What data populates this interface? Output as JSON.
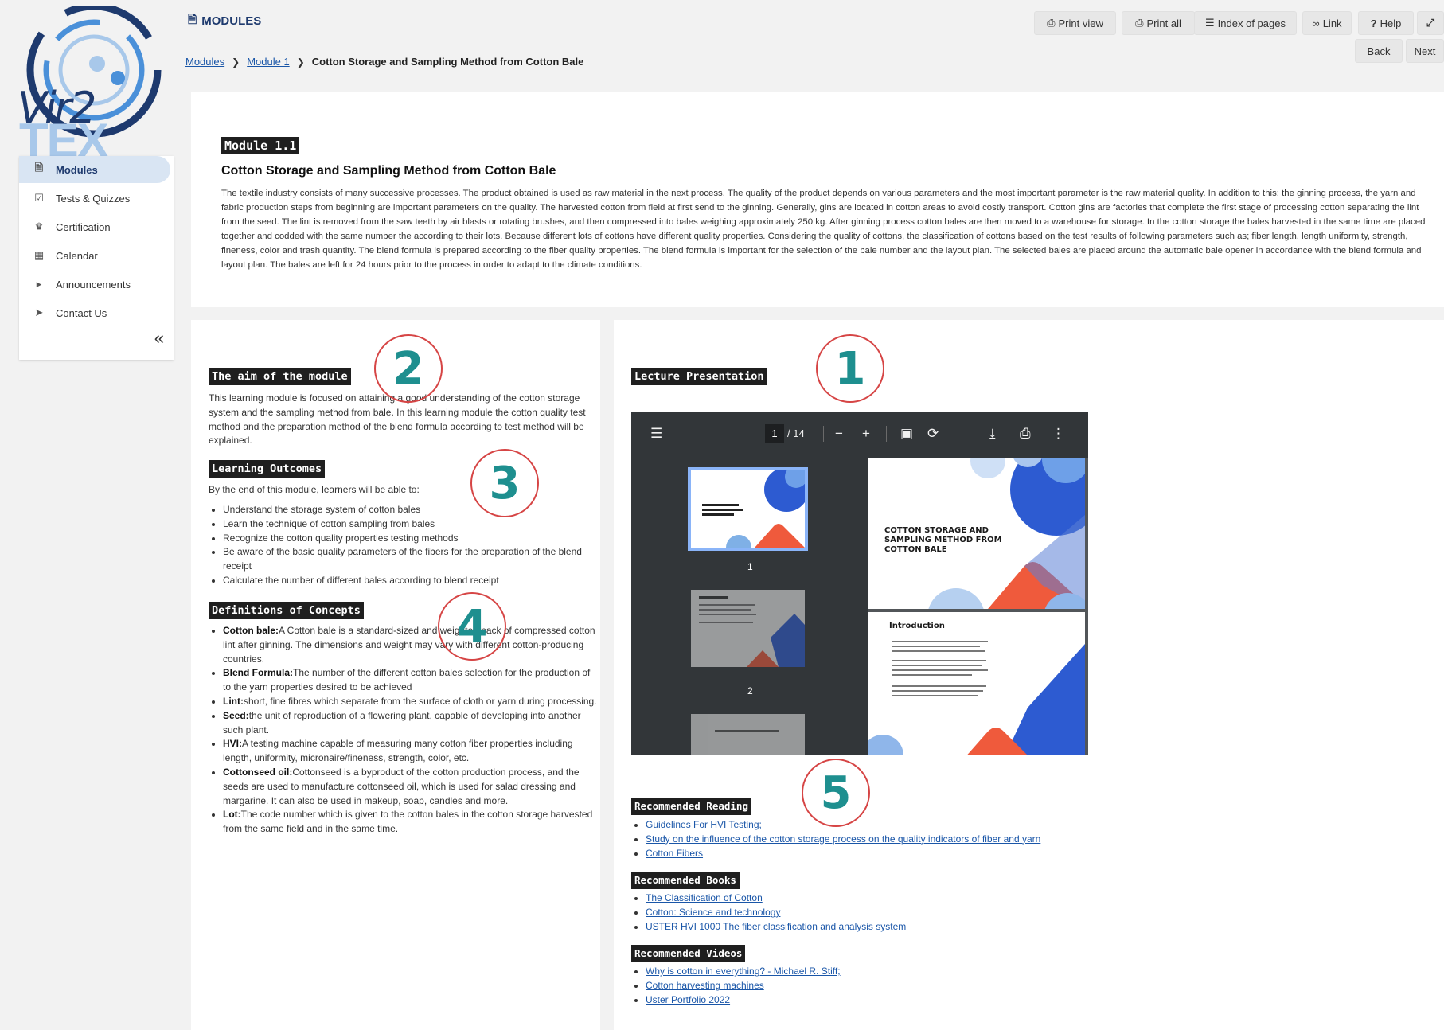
{
  "header": {
    "title": "MODULES",
    "toolbar": [
      {
        "label": "Print view",
        "icon": "print-icon"
      },
      {
        "label": "Print all",
        "icon": "print-icon"
      },
      {
        "label": "Index of pages",
        "icon": "list-icon"
      },
      {
        "label": "Link",
        "icon": "link-icon"
      },
      {
        "label": "Help",
        "icon": "help-icon"
      },
      {
        "label": "",
        "icon": "fullscreen-icon"
      }
    ],
    "back_label": "Back",
    "next_label": "Next"
  },
  "breadcrumb": [
    "Modules",
    "Module 1",
    "Cotton Storage and Sampling Method from Cotton Bale"
  ],
  "logo": {
    "line1": "Vir2",
    "line2": "TEX"
  },
  "sidebar": {
    "items": [
      {
        "label": "Modules",
        "icon": "document-icon",
        "active": true
      },
      {
        "label": "Tests & Quizzes",
        "icon": "checkbox-icon",
        "active": false
      },
      {
        "label": "Certification",
        "icon": "trophy-icon",
        "active": false
      },
      {
        "label": "Calendar",
        "icon": "calendar-icon",
        "active": false
      },
      {
        "label": "Announcements",
        "icon": "megaphone-icon",
        "active": false
      },
      {
        "label": "Contact Us",
        "icon": "paper-plane-icon",
        "active": false
      }
    ],
    "collapse_label": "«"
  },
  "module": {
    "tag": "Module 1.1",
    "title": "Cotton Storage and Sampling Method from Cotton Bale",
    "intro": "The textile industry consists of many successive processes. The product obtained is used as raw material in the next process. The quality of the product depends on various parameters and the most important parameter is the raw material quality. In addition to this; the ginning process, the yarn and fabric production steps from beginning are important parameters on the quality. The harvested cotton from field at first send to the ginning. Generally, gins are located in cotton areas to avoid costly transport. Cotton gins are factories that complete the first stage of processing cotton separating the lint from the seed. The lint is removed from the saw teeth by air blasts or rotating brushes, and then compressed into bales weighing approximately 250 kg. After ginning process cotton bales are then moved to a warehouse for storage. In the cotton storage the bales harvested in the same time are placed together and codded with the same number the according to their lots. Because different lots of cottons have different quality properties. Considering the quality of cottons, the classification of cottons based on the test results of following parameters such as; fiber length, length uniformity, strength, fineness, color and trash quantity. The blend formula is prepared according to the fiber quality properties. The blend formula is important for the selection of the bale number and the layout plan. The selected bales are placed around the automatic bale opener in accordance with the blend formula and layout plan. The bales are left for 24 hours prior to the process in order to adapt to the climate conditions."
  },
  "aim": {
    "heading": "The aim of the module",
    "text": "This learning module is focused on attaining a good understanding of the cotton storage system and the sampling method from bale. In this learning module the cotton quality test method and the preparation method of the blend formula according to test method will be explained."
  },
  "outcomes": {
    "heading": "Learning Outcomes",
    "intro": "By the end of this module, learners will be able to:",
    "items": [
      "Understand the storage system of cotton bales",
      "Learn the technique of cotton sampling from bales",
      "Recognize the cotton quality properties testing methods",
      "Be aware of the basic quality parameters of the fibers for the preparation of the blend receipt",
      "Calculate the number of different bales according to blend receipt"
    ]
  },
  "concepts": {
    "heading": "Definitions of Concepts",
    "items": [
      {
        "term": "Cotton bale:",
        "def": "A Cotton bale is a standard-sized and weighted pack of compressed cotton lint after ginning. The dimensions and weight may vary with different cotton-producing countries."
      },
      {
        "term": "Blend Formula:",
        "def": "The number of the different cotton bales selection for the production of to the yarn properties desired to be achieved"
      },
      {
        "term": "Lint:",
        "def": "short, fine fibres which separate from the surface of cloth or yarn during processing."
      },
      {
        "term": "Seed:",
        "def": "the unit of reproduction of a flowering plant, capable of developing into another such plant."
      },
      {
        "term": "HVI:",
        "def": "A testing machine capable of measuring many cotton fiber properties including length, uniformity, micronaire/fineness, strength, color, etc."
      },
      {
        "term": "Cottonseed oil:",
        "def": "Cottonseed is a byproduct of the cotton production process, and the seeds are used to manufacture cottonseed oil, which is used for salad dressing and margarine. It can also be used in makeup, soap, candles and more."
      },
      {
        "term": "Lot:",
        "def": "The code number which is given to the cotton bales in the cotton storage harvested from the same field and in the same time."
      }
    ]
  },
  "presentation": {
    "heading": "Lecture Presentation",
    "page_current": "1",
    "page_total": "/ 14",
    "thumb_labels": [
      "1",
      "2"
    ],
    "slide1_title": "COTTON STORAGE AND SAMPLING METHOD FROM COTTON BALE",
    "slide2_title": "Introduction"
  },
  "reading": {
    "heading": "Recommended Reading",
    "links": [
      "Guidelines For HVI Testing;",
      "Study on the influence of the cotton storage process on the quality indicators of fiber and yarn",
      "Cotton Fibers"
    ]
  },
  "books": {
    "heading": "Recommended Books",
    "links": [
      "The Classification of Cotton",
      "Cotton: Science and technology",
      "USTER HVI 1000 The fiber classification and analysis system"
    ]
  },
  "videos": {
    "heading": "Recommended Videos",
    "links": [
      "Why is cotton in everything? - Michael R. Stiff;",
      "Cotton harvesting machines",
      "Uster Portfolio 2022"
    ]
  },
  "markers": [
    "1",
    "2",
    "3",
    "4",
    "5"
  ],
  "colors": {
    "brand_navy": "#1e3a6e",
    "brand_light_blue": "#a8c8ea",
    "link": "#1a56a8",
    "marker_circle": "#d64545",
    "marker_number": "#1e8f8f",
    "slide_blue": "#2d5bd1",
    "slide_orange": "#ef5a3c"
  }
}
